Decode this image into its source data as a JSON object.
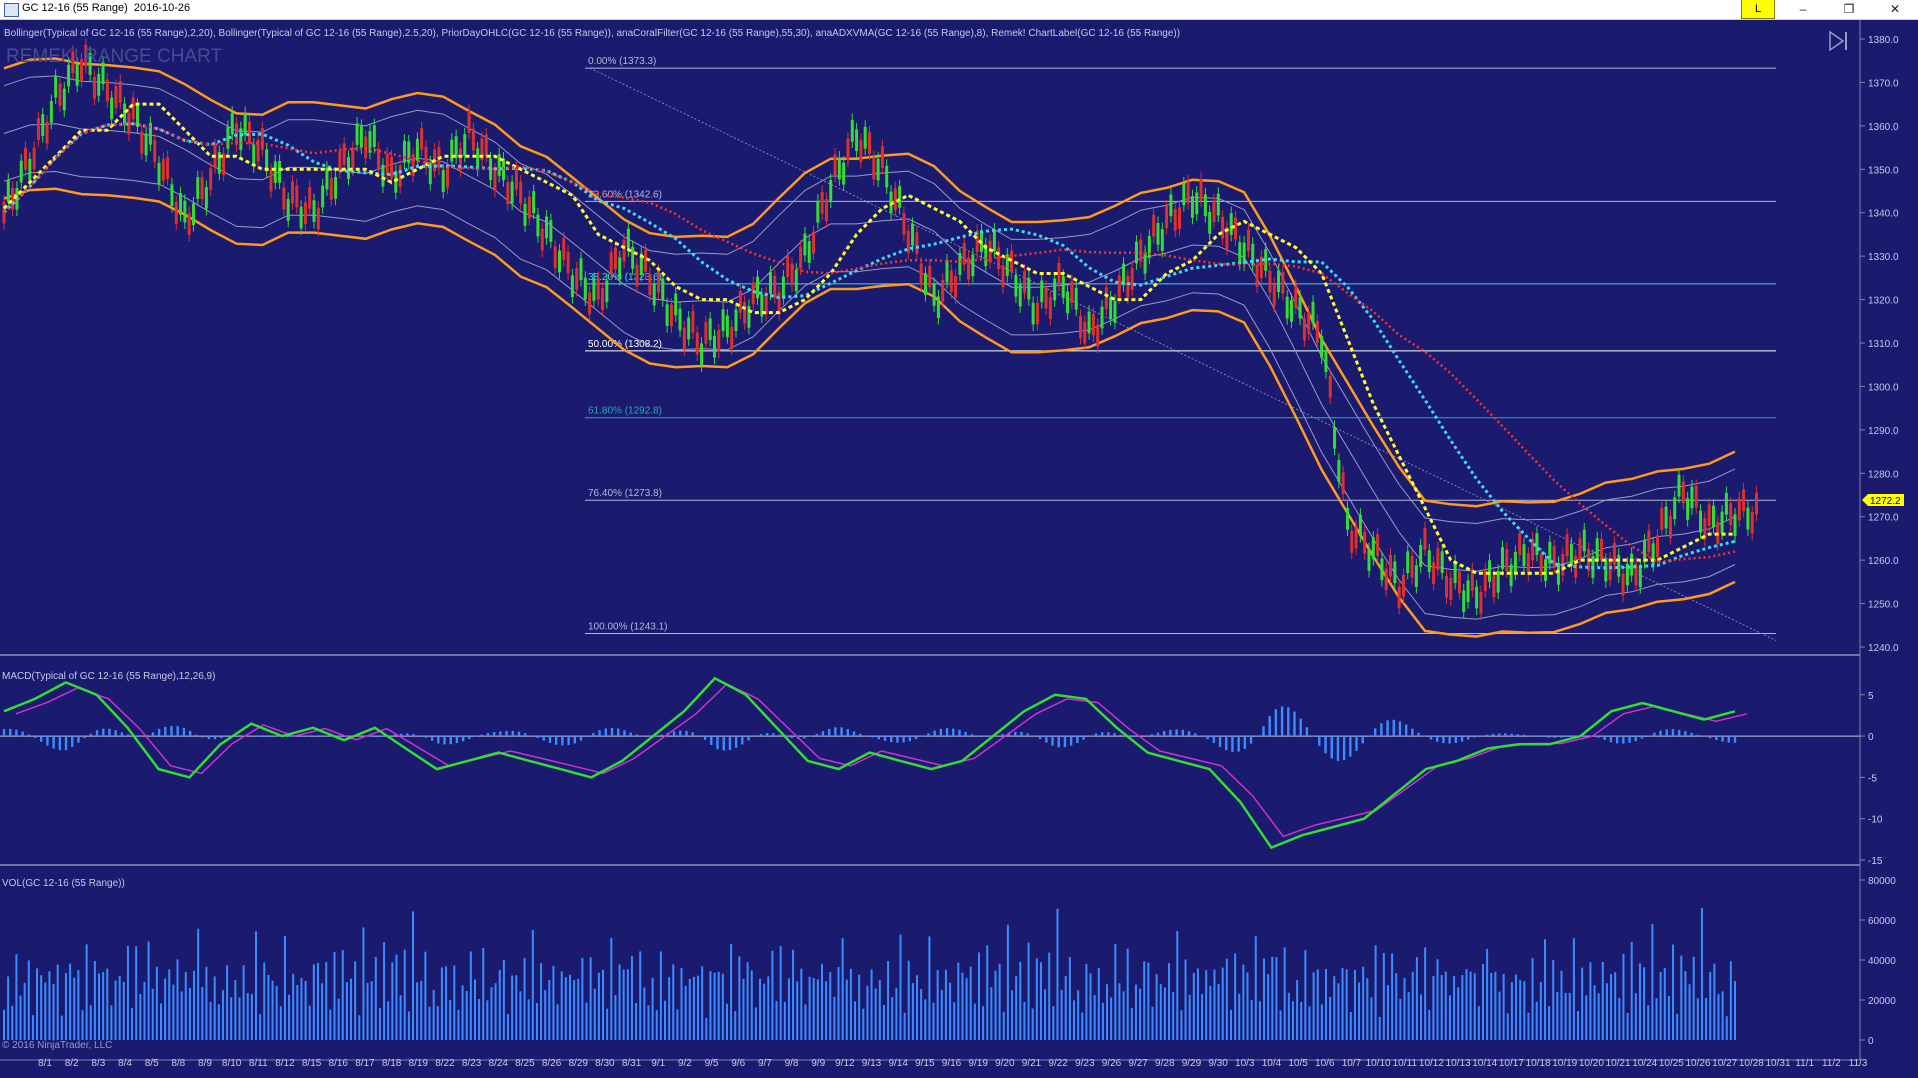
{
  "window": {
    "title": "GC 12-16 (55 Range)  2016-10-26",
    "badge": "L",
    "minimize_glyph": "–",
    "restore_glyph": "❐",
    "close_glyph": "✕"
  },
  "colors": {
    "background": "#1a1a6e",
    "bollinger_outer": "#ff9a1f",
    "bollinger_inner": "#9a9ac8",
    "coral": "#3fd7f0",
    "adxvma": "#ffff33",
    "prior_day": "#ff3030",
    "macd": "#33dd33",
    "macd_signal": "#cc33cc",
    "histogram": "#3c8cff",
    "volume": "#3c8cff",
    "price_marker": "#ffff00"
  },
  "indicator_label": "Bollinger(Typical of GC 12-16 (55 Range),2,20), Bollinger(Typical of GC 12-16 (55 Range),2.5,20), PriorDayOHLC(GC 12-16 (55 Range)), anaCoralFilter(GC 12-16 (55 Range),55,30), anaADXVMA(GC 12-16 (55 Range),8), Remek! ChartLabel(GC 12-16 (55 Range))",
  "watermark": "REMEK! RANGE CHART",
  "macd_label": "MACD(Typical of GC 12-16 (55 Range),12,26,9)",
  "vol_label": "VOL(GC 12-16 (55 Range))",
  "copyright": "© 2016 NinjaTrader, LLC",
  "current_price": "1272.2",
  "chart_data": [
    {
      "type": "line",
      "name": "price",
      "ylim": [
        1240,
        1380
      ],
      "y_ticks": [
        "1380.0",
        "1370.0",
        "1360.0",
        "1350.0",
        "1340.0",
        "1330.0",
        "1320.0",
        "1310.0",
        "1300.0",
        "1290.0",
        "1280.0",
        "1270.0",
        "1260.0",
        "1250.0",
        "1240.0"
      ],
      "fib_levels": [
        {
          "label": "0.00% (1373.3)",
          "value": 1373.3,
          "color": "#b8b8d8"
        },
        {
          "label": "23.60% (1342.6)",
          "value": 1342.6,
          "color": "#b8b8d8"
        },
        {
          "label": "38.20% (1323.6)",
          "value": 1323.6,
          "color": "#3fd7f0"
        },
        {
          "label": "50.00% (1308.2)",
          "value": 1308.2,
          "color": "#ffffff"
        },
        {
          "label": "61.80% (1292.8)",
          "value": 1292.8,
          "color": "#2fa8b8"
        },
        {
          "label": "76.40% (1273.8)",
          "value": 1273.8,
          "color": "#b8b8d8"
        },
        {
          "label": "100.00% (1243.1)",
          "value": 1243.1,
          "color": "#b8b8d8"
        }
      ],
      "close_series": [
        1340,
        1352,
        1366,
        1375,
        1368,
        1362,
        1352,
        1338,
        1348,
        1360,
        1354,
        1343,
        1340,
        1350,
        1358,
        1348,
        1355,
        1349,
        1358,
        1350,
        1344,
        1335,
        1326,
        1320,
        1332,
        1325,
        1316,
        1310,
        1313,
        1320,
        1322,
        1330,
        1346,
        1358,
        1350,
        1336,
        1320,
        1327,
        1333,
        1326,
        1318,
        1324,
        1312,
        1320,
        1330,
        1338,
        1344,
        1339,
        1332,
        1325,
        1318,
        1312,
        1268,
        1262,
        1254,
        1262,
        1255,
        1252,
        1258,
        1262,
        1259,
        1262,
        1260,
        1256,
        1265,
        1276,
        1268,
        1271
      ]
    },
    {
      "type": "line",
      "name": "MACD",
      "ylim": [
        -15,
        8
      ],
      "y_ticks": [
        "5",
        "0",
        "-5",
        "-10",
        "-15"
      ],
      "values": [
        3,
        4.5,
        6.5,
        5,
        1,
        -4,
        -5,
        -1,
        1.5,
        0,
        1,
        -0.5,
        1,
        -1.5,
        -4,
        -3,
        -2,
        -3,
        -4,
        -5,
        -3,
        0,
        3,
        7,
        5,
        1,
        -3,
        -4,
        -2,
        -3,
        -4,
        -3,
        0,
        3,
        5,
        4.5,
        1,
        -2,
        -3,
        -4,
        -8,
        -13.5,
        -12,
        -11,
        -10,
        -7,
        -4,
        -3,
        -1.5,
        -1,
        -1,
        0,
        3,
        4,
        3,
        2,
        3
      ]
    },
    {
      "type": "bar",
      "name": "VOL",
      "ylim": [
        0,
        80000
      ],
      "y_ticks": [
        "80000",
        "60000",
        "40000",
        "20000",
        "0"
      ],
      "values": [
        25000,
        32000,
        40000,
        45000,
        30000,
        38000,
        42000,
        28000,
        36000,
        55000,
        33000,
        40000,
        46000,
        38000,
        29000,
        35000,
        52000,
        41000,
        37000,
        33000,
        48000,
        30000,
        45000,
        39000,
        55000,
        36000,
        42000,
        31000,
        44000,
        38000,
        50000,
        35000,
        47000,
        40000,
        33000,
        58000,
        41000,
        37000,
        45000,
        32000,
        49000,
        36000,
        43000,
        52000,
        34000,
        46000,
        39000,
        66000,
        42000,
        37000,
        48000,
        33000
      ]
    }
  ],
  "x_axis_labels": [
    "8/1",
    "8/2",
    "8/3",
    "8/4",
    "8/5",
    "8/8",
    "8/9",
    "8/10",
    "8/11",
    "8/12",
    "8/15",
    "8/16",
    "8/17",
    "8/18",
    "8/19",
    "8/22",
    "8/23",
    "8/24",
    "8/25",
    "8/26",
    "8/29",
    "8/30",
    "8/31",
    "9/1",
    "9/2",
    "9/5",
    "9/6",
    "9/7",
    "9/8",
    "9/9",
    "9/12",
    "9/13",
    "9/14",
    "9/15",
    "9/16",
    "9/19",
    "9/20",
    "9/21",
    "9/22",
    "9/23",
    "9/26",
    "9/27",
    "9/28",
    "9/29",
    "9/30",
    "10/3",
    "10/4",
    "10/5",
    "10/6",
    "10/7",
    "10/10",
    "10/11",
    "10/12",
    "10/13",
    "10/14",
    "10/17",
    "10/18",
    "10/19",
    "10/20",
    "10/21",
    "10/24",
    "10/25",
    "10/26",
    "10/27",
    "10/28",
    "10/31",
    "11/1",
    "11/2",
    "11/3"
  ]
}
